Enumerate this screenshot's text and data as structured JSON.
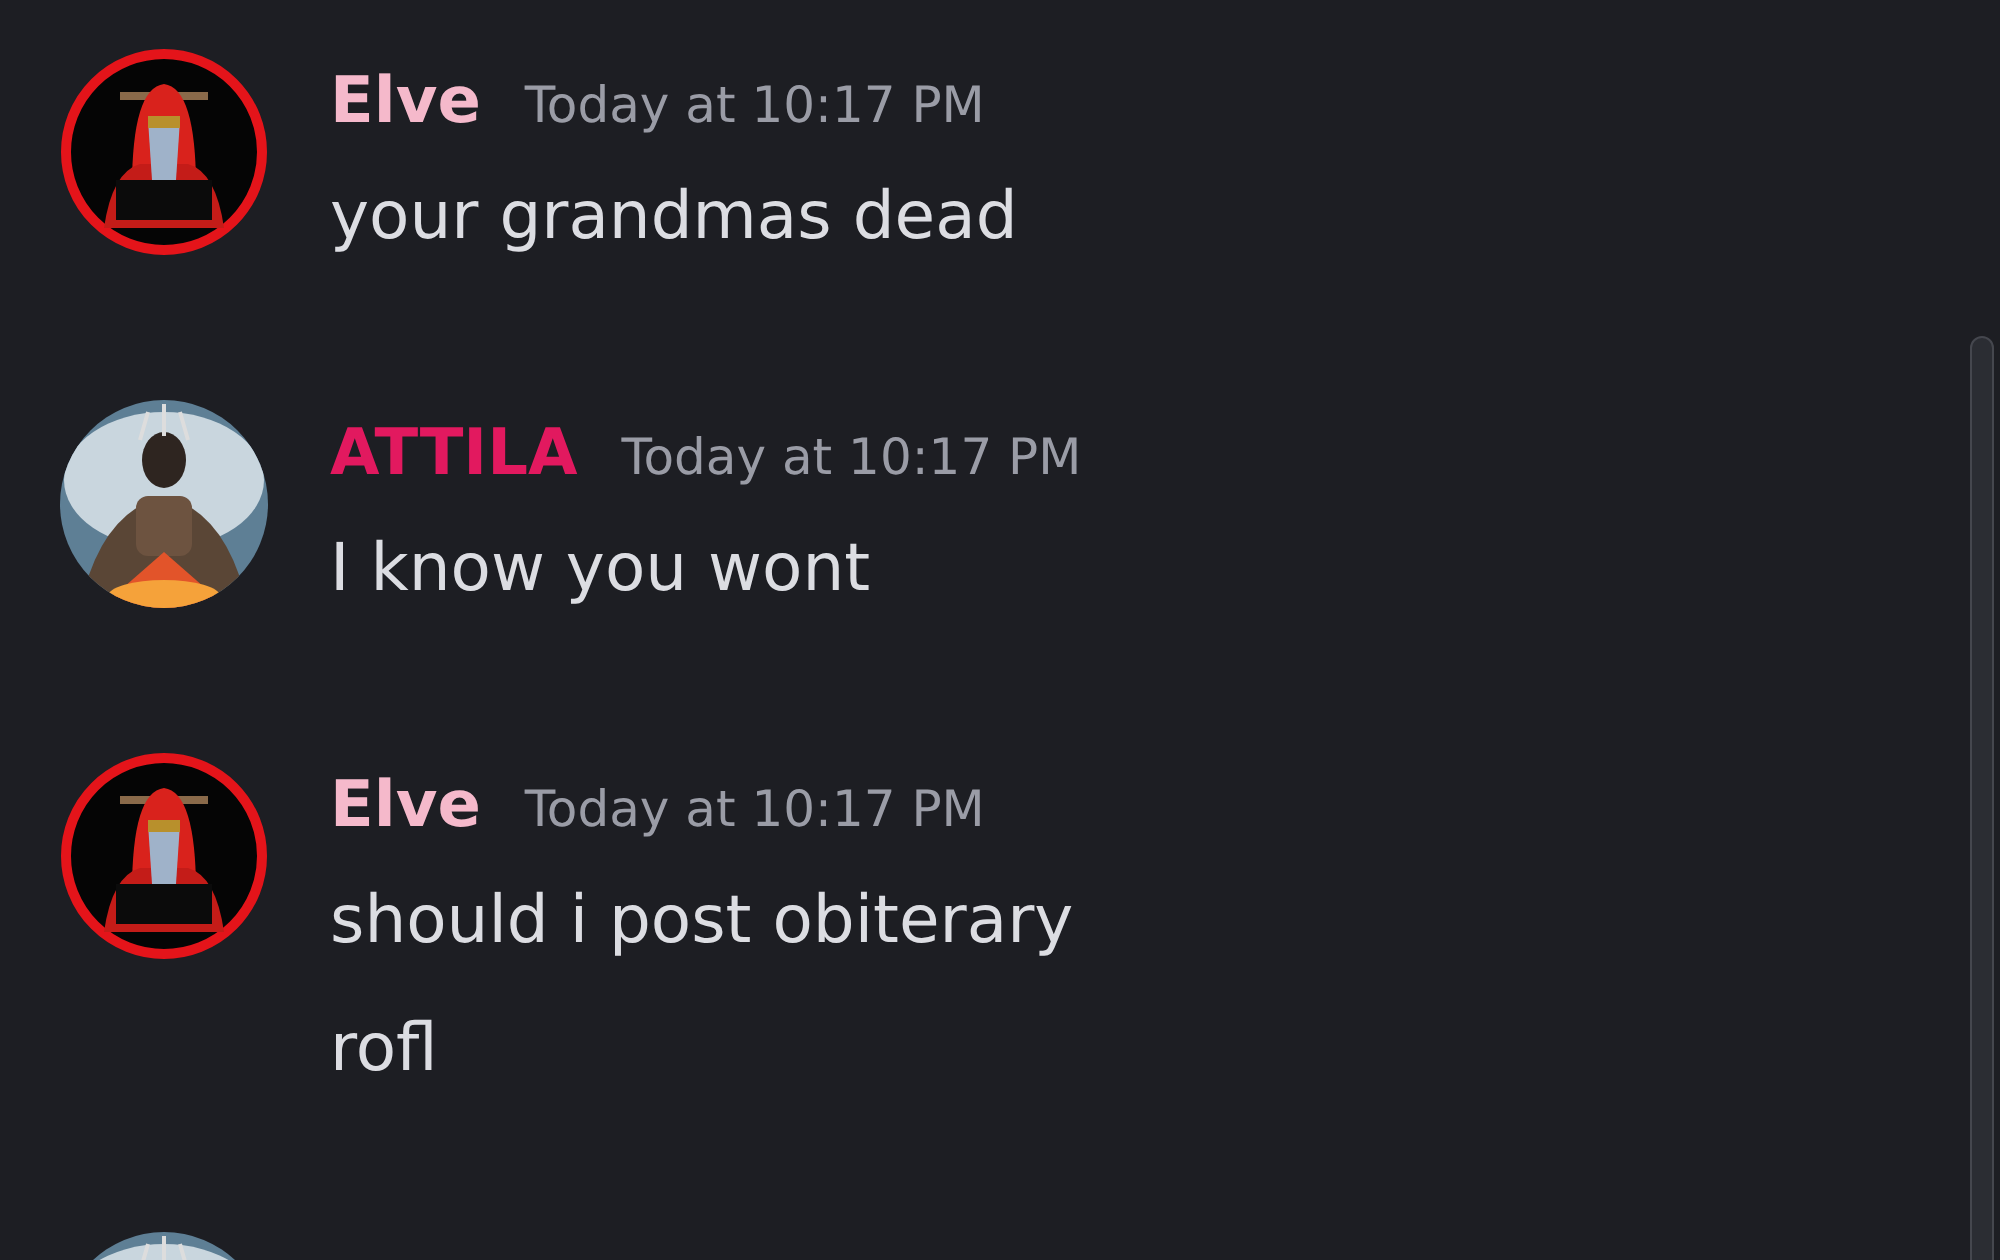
{
  "messages": [
    {
      "author": "Elve",
      "color": "#f5b9cb",
      "timestamp": "Today at 10:17 PM",
      "avatar": {
        "kind": "hood"
      },
      "lines": [
        "your grandmas dead"
      ]
    },
    {
      "author": "ATTILA",
      "color": "#e2195f",
      "timestamp": "Today at 10:17 PM",
      "avatar": {
        "kind": "warrior"
      },
      "lines": [
        "I know you wont"
      ]
    },
    {
      "author": "Elve",
      "color": "#f5b9cb",
      "timestamp": "Today at 10:17 PM",
      "avatar": {
        "kind": "hood"
      },
      "lines": [
        "should i post obiterary",
        "rofl"
      ]
    },
    {
      "avatar": {
        "kind": "warrior"
      }
    }
  ]
}
